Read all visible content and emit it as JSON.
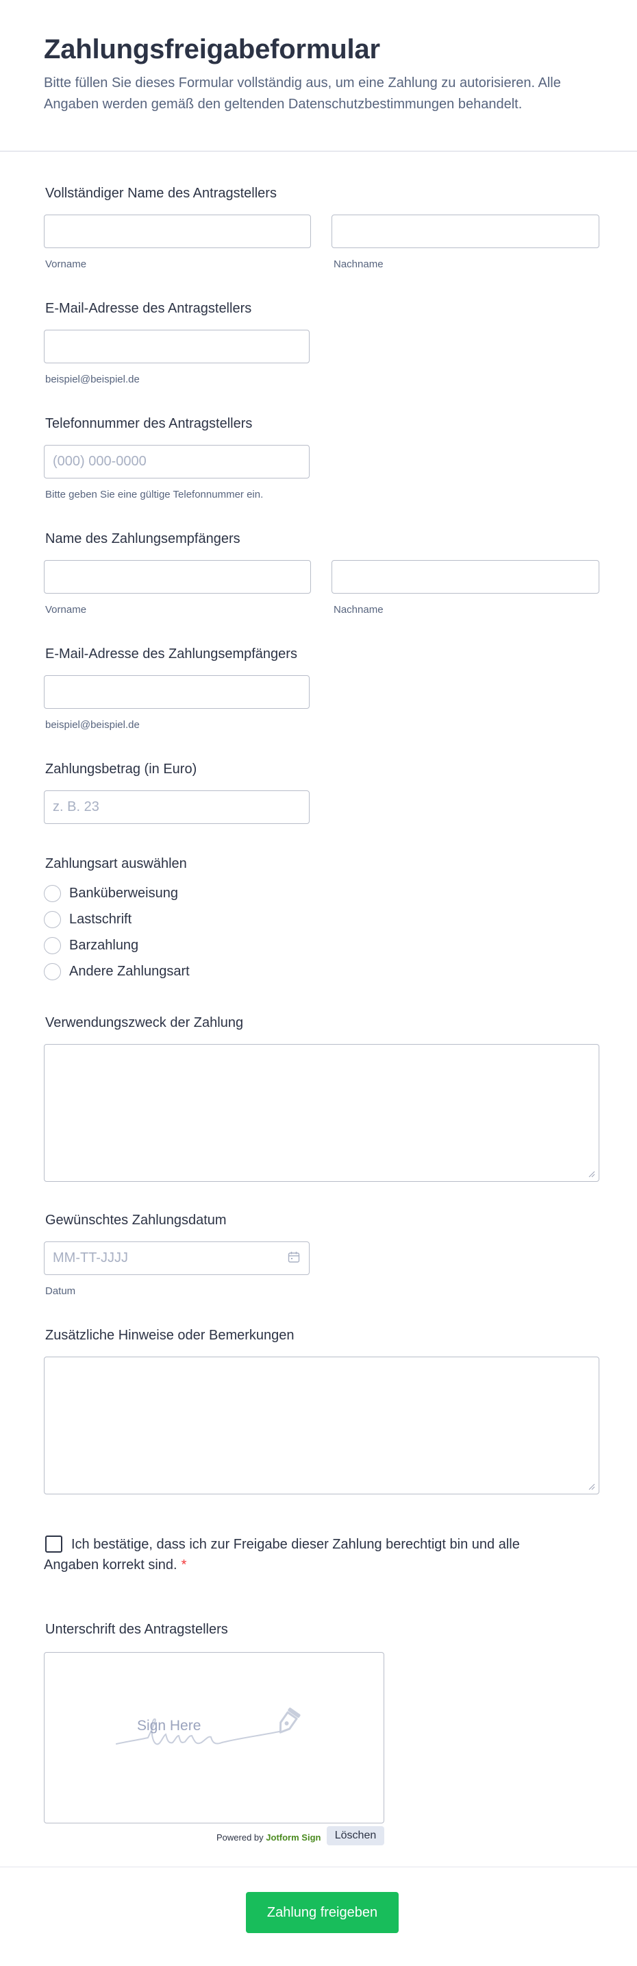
{
  "form": {
    "title": "Zahlungsfreigabeformular",
    "subtitle": "Bitte füllen Sie dieses Formular vollständig aus, um eine Zahlung zu autorisieren. Alle Angaben werden gemäß den geltenden Datenschutzbestimmungen behandelt."
  },
  "applicant_name": {
    "label": "Vollständiger Name des Antragstellers",
    "first_sublabel": "Vorname",
    "last_sublabel": "Nachname",
    "first_value": "",
    "last_value": ""
  },
  "applicant_email": {
    "label": "E-Mail-Adresse des Antragstellers",
    "sublabel": "beispiel@beispiel.de",
    "value": ""
  },
  "applicant_phone": {
    "label": "Telefonnummer des Antragstellers",
    "placeholder": "(000) 000-0000",
    "sublabel": "Bitte geben Sie eine gültige Telefonnummer ein.",
    "value": ""
  },
  "payee_name": {
    "label": "Name des Zahlungsempfängers",
    "first_sublabel": "Vorname",
    "last_sublabel": "Nachname",
    "first_value": "",
    "last_value": ""
  },
  "payee_email": {
    "label": "E-Mail-Adresse des Zahlungsempfängers",
    "sublabel": "beispiel@beispiel.de",
    "value": ""
  },
  "amount": {
    "label": "Zahlungsbetrag (in Euro)",
    "placeholder": "z. B. 23",
    "value": ""
  },
  "payment_method": {
    "label": "Zahlungsart auswählen",
    "options": [
      "Banküberweisung",
      "Lastschrift",
      "Barzahlung",
      "Andere Zahlungsart"
    ]
  },
  "purpose": {
    "label": "Verwendungszweck der Zahlung",
    "value": ""
  },
  "payment_date": {
    "label": "Gewünschtes Zahlungsdatum",
    "placeholder": "MM-TT-JJJJ",
    "sublabel": "Datum",
    "icon": "calendar-icon",
    "value": ""
  },
  "notes": {
    "label": "Zusätzliche Hinweise oder Bemerkungen",
    "value": ""
  },
  "consent": {
    "text": "Ich bestätige, dass ich zur Freigabe dieser Zahlung berechtigt bin und alle Angaben korrekt sind.",
    "required_mark": "*",
    "checked": false
  },
  "signature": {
    "label": "Unterschrift des Antragstellers",
    "hint": "Sign Here",
    "powered_prefix": "Powered by",
    "powered_brand": "Jotform Sign",
    "clear_label": "Löschen"
  },
  "submit": {
    "label": "Zahlung freigeben"
  },
  "colors": {
    "submit": "#18bd5b",
    "required": "#f23a3c",
    "brand": "#4a8a1f",
    "text": "#2c3345",
    "muted": "#57647e"
  }
}
